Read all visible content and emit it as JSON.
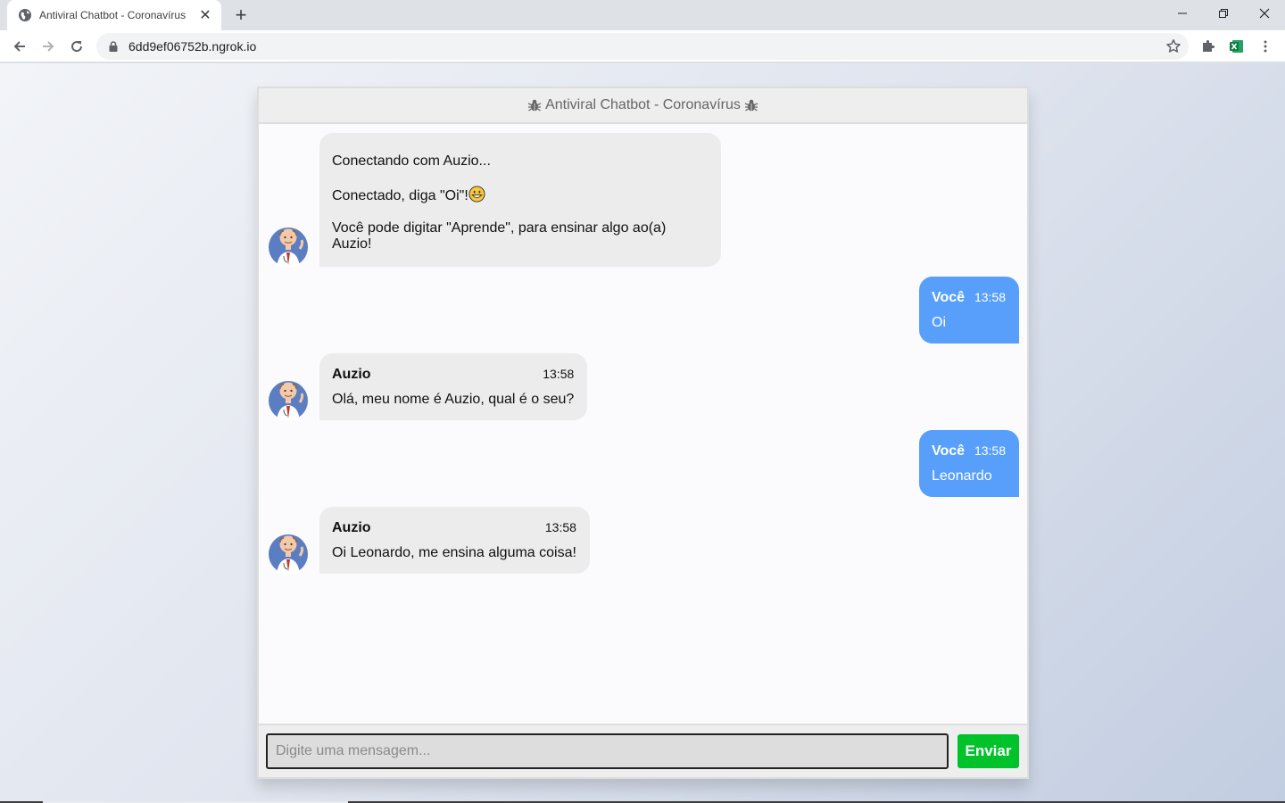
{
  "browser": {
    "tab_title": "Antiviral Chatbot - Coronavírus",
    "url": "6dd9ef06752b.ngrok.io"
  },
  "chat": {
    "header_title": "Antiviral Chatbot - Coronavírus",
    "intro": {
      "line1": "Conectando com Auzio...",
      "line2": "Conectado, diga \"Oi\"!",
      "line3": "Você pode digitar \"Aprende\", para ensinar algo ao(a) Auzio!"
    },
    "messages": [
      {
        "side": "right",
        "name": "Você",
        "time": "13:58",
        "text": "Oi"
      },
      {
        "side": "left",
        "name": "Auzio",
        "time": "13:58",
        "text": "Olá, meu nome é Auzio, qual é o seu?"
      },
      {
        "side": "right",
        "name": "Você",
        "time": "13:58",
        "text": "Leonardo"
      },
      {
        "side": "left",
        "name": "Auzio",
        "time": "13:58",
        "text": "Oi Leonardo, me ensina alguma coisa!"
      }
    ],
    "input_placeholder": "Digite uma mensagem...",
    "send_label": "Enviar"
  },
  "colors": {
    "bot_bubble": "#ececec",
    "user_bubble": "#579ffb",
    "send_button": "#00c22b",
    "header_bg": "#eeeeee"
  },
  "icons": {
    "tab": "globe-icon",
    "header": "bug-icon",
    "avatar": "doctor-avatar",
    "emoji": "grinning-face-emoji"
  }
}
